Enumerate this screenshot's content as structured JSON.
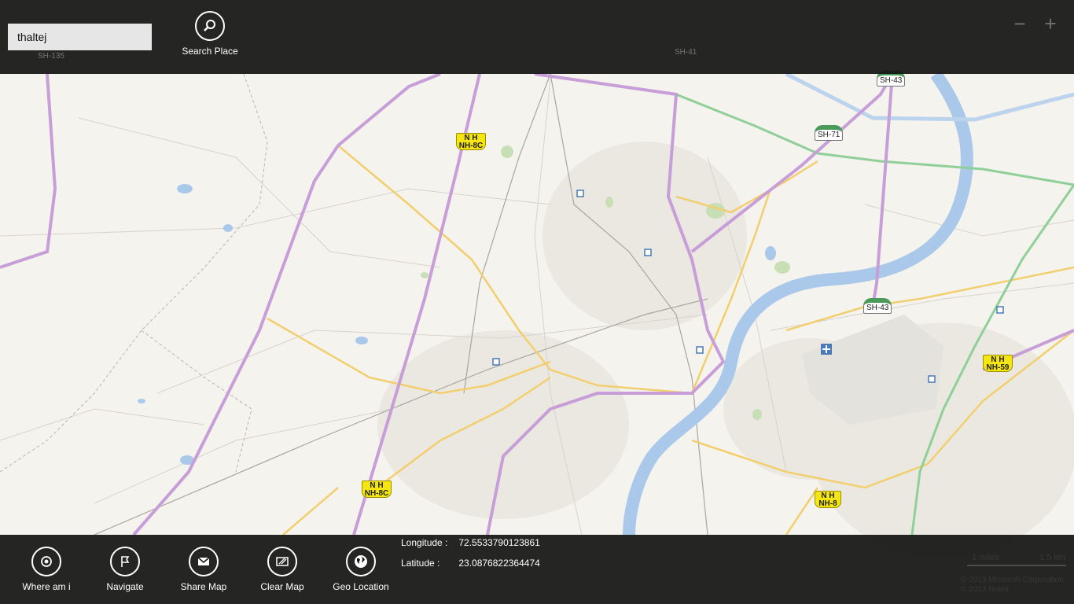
{
  "search": {
    "value": "thaltej",
    "button_label": "Search Place",
    "icon": "search-icon"
  },
  "zoom": {
    "out_label": "−",
    "in_label": "+"
  },
  "map": {
    "shields": {
      "nh8c_top": {
        "top": "N H",
        "num": "NH-8C"
      },
      "nh8c_bottom": {
        "top": "N H",
        "num": "NH-8C"
      },
      "nh8": {
        "top": "N H",
        "num": "NH-8"
      },
      "nh59": {
        "top": "N H",
        "num": "NH-59"
      },
      "sh43_top": "SH-43",
      "sh71": "SH-71",
      "sh43_mid": "SH-43",
      "sh41": "SH-41",
      "sh135": "SH-135"
    },
    "scale": {
      "miles": "1 miles",
      "km": "1.5 km"
    },
    "copyright": [
      "© 2013 Microsoft Corporation",
      "© 2013 Nokia"
    ],
    "colors": {
      "water": "#a9c8ea",
      "highway": "#c79ed8",
      "main_road": "#f2cf6e",
      "green_route": "#8fcf98",
      "land": "#f5f3ee"
    }
  },
  "appbar": {
    "buttons": [
      {
        "label": "Where am i",
        "icon": "target-icon"
      },
      {
        "label": "Navigate",
        "icon": "flag-icon"
      },
      {
        "label": "Share Map",
        "icon": "mail-icon"
      },
      {
        "label": "Clear Map",
        "icon": "eraser-icon"
      },
      {
        "label": "Geo Location",
        "icon": "globe-icon"
      }
    ],
    "longitude": {
      "label": "Longitude :",
      "value": "72.5533790123861"
    },
    "latitude": {
      "label": "Latitude :",
      "value": "23.0876822364474"
    }
  }
}
